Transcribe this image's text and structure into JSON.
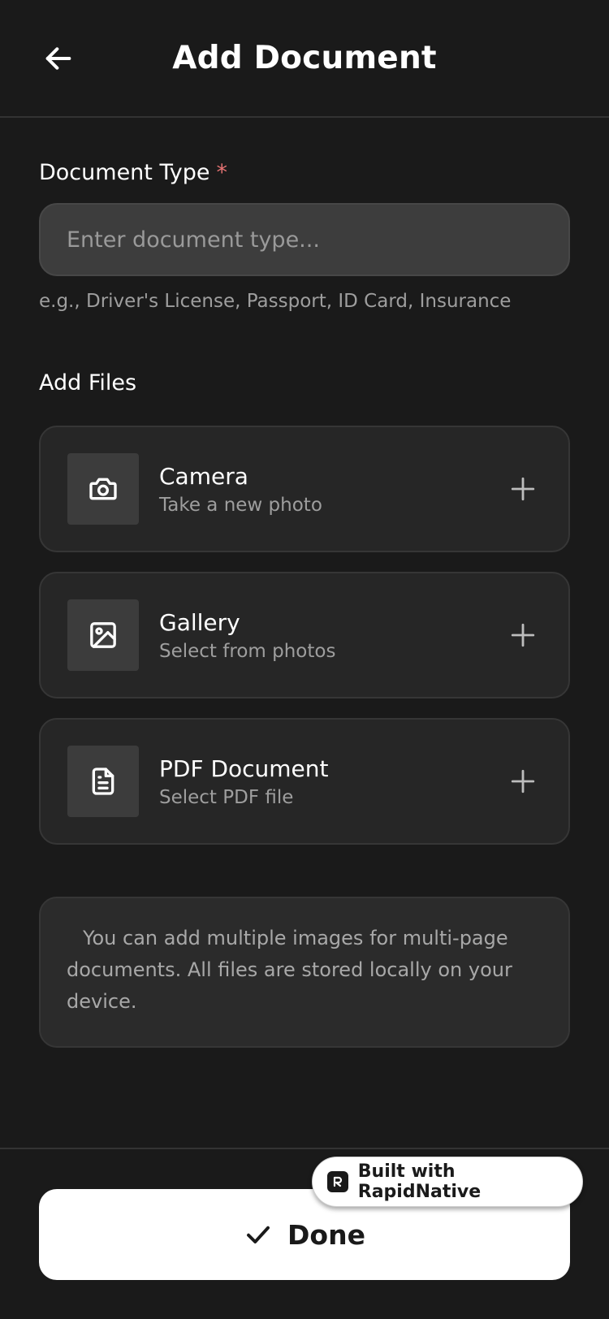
{
  "header": {
    "title": "Add Document",
    "back_icon": "arrow-left-icon"
  },
  "document_type": {
    "label": "Document Type",
    "required_mark": "*",
    "required_color": "#e57373",
    "placeholder": "Enter document type...",
    "value": "",
    "hint": "e.g., Driver's License, Passport, ID Card, Insurance"
  },
  "add_files": {
    "label": "Add Files",
    "options": [
      {
        "title": "Camera",
        "subtitle": "Take a new photo",
        "icon": "camera-icon",
        "action_icon": "plus-icon"
      },
      {
        "title": "Gallery",
        "subtitle": "Select from photos",
        "icon": "image-icon",
        "action_icon": "plus-icon"
      },
      {
        "title": "PDF Document",
        "subtitle": "Select PDF file",
        "icon": "file-text-icon",
        "action_icon": "plus-icon"
      }
    ]
  },
  "info": {
    "text": "You can add multiple images for multi-page documents. All files are stored locally on your device."
  },
  "footer": {
    "done_label": "Done",
    "done_icon": "check-icon",
    "badge_label": "Built with RapidNative",
    "badge_icon": "rapidnative-logo-icon"
  },
  "colors": {
    "background": "#1a1a1a",
    "card": "#262626",
    "input": "#3d3d3d",
    "primary_button": "#ffffff"
  }
}
